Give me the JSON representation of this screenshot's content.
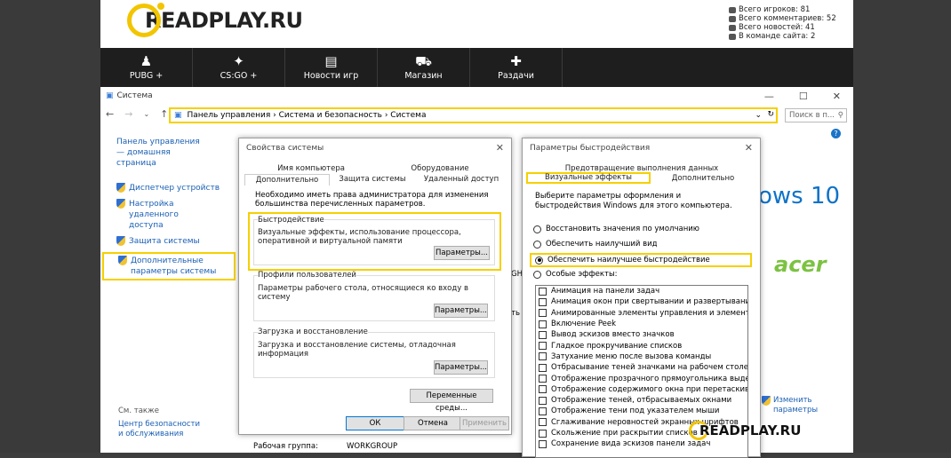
{
  "site": {
    "logo_text": "READPLAY.RU",
    "stats": [
      "Всего игроков: 81",
      "Всего комментариев: 52",
      "Всего новостей: 41",
      "В команде сайта: 2"
    ],
    "nav": [
      {
        "label": "PUBG +",
        "icon": "person-icon"
      },
      {
        "label": "CS:GO +",
        "icon": "soldier-icon"
      },
      {
        "label": "Новости игр",
        "icon": "document-icon"
      },
      {
        "label": "Магазин",
        "icon": "cart-icon"
      },
      {
        "label": "Раздачи",
        "icon": "plus-icon"
      }
    ]
  },
  "window": {
    "title": "Система",
    "address": "Панель управления  ›  Система и безопасность  ›  Система",
    "search_placeholder": "Поиск в п..."
  },
  "sidebar": {
    "home": "Панель управления — домашняя страница",
    "items": [
      "Диспетчер устройств",
      "Настройка удаленного доступа",
      "Защита системы",
      "Дополнительные параметры системы"
    ],
    "see_also": "См. также",
    "see_also_item": "Центр безопасности и обслуживания"
  },
  "main": {
    "win10": "ows 10",
    "acer": "acer",
    "change": "Изменить параметры",
    "workgroup_label": "Рабочая группа:",
    "workgroup_value": "WORKGROUP",
    "frag1": "GH",
    "frag2": "ть"
  },
  "sysprops": {
    "title": "Свойства системы",
    "tabs_row1": [
      "Имя компьютера",
      "Оборудование"
    ],
    "tabs_row2": [
      "Дополнительно",
      "Защита системы",
      "Удаленный доступ"
    ],
    "admin_note": "Необходимо иметь права администратора для изменения большинства перечисленных параметров.",
    "perf_title": "Быстродействие",
    "perf_desc": "Визуальные эффекты, использование процессора, оперативной и виртуальной памяти",
    "profiles_title": "Профили пользователей",
    "profiles_desc": "Параметры рабочего стола, относящиеся ко входу в систему",
    "startup_title": "Загрузка и восстановление",
    "startup_desc": "Загрузка и восстановление системы, отладочная информация",
    "params_btn": "Параметры...",
    "env_btn": "Переменные среды...",
    "ok": "ОК",
    "cancel": "Отмена",
    "apply": "Применить"
  },
  "perf": {
    "title": "Параметры быстродействия",
    "tab_top": "Предотвращение выполнения данных",
    "tabs": [
      "Визуальные эффекты",
      "Дополнительно"
    ],
    "desc": "Выберите параметры оформления и быстродействия Windows для этого компьютера.",
    "radios": [
      "Восстановить значения по умолчанию",
      "Обеспечить наилучший вид",
      "Обеспечить наилучшее быстродействие",
      "Особые эффекты:"
    ],
    "effects": [
      "Анимация на панели задач",
      "Анимация окон при свертывании и развертывании",
      "Анимированные элементы управления и элементы внут",
      "Включение Peek",
      "Вывод эскизов вместо значков",
      "Гладкое прокручивание списков",
      "Затухание меню после вызова команды",
      "Отбрасывание теней значками на рабочем столе",
      "Отображение прозрачного прямоугольника выделения",
      "Отображение содержимого окна при перетаскивании",
      "Отображение теней, отбрасываемых окнами",
      "Отображение тени под указателем мыши",
      "Сглаживание неровностей экранных шрифтов",
      "Скольжение при раскрытии списков",
      "Сохранение вида эскизов панели задач"
    ]
  },
  "watermark": "READPLAY.RU"
}
